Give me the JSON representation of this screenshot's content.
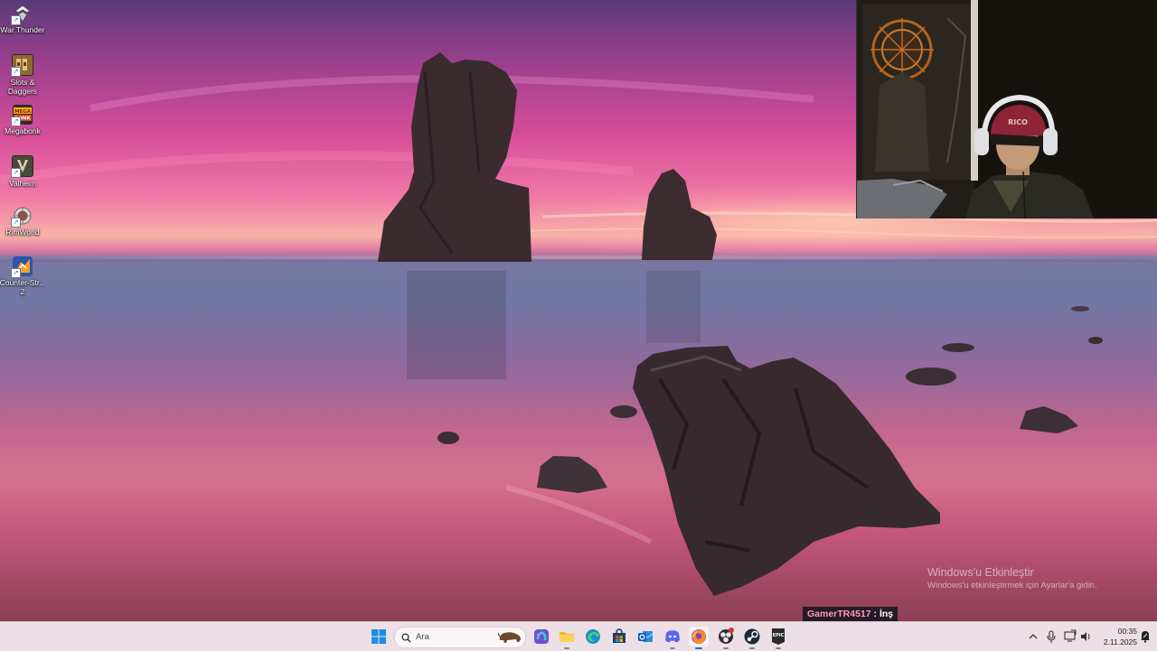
{
  "desktop_icons": [
    {
      "label": "War Thunder",
      "icon": "war-thunder-icon",
      "color": "#5b6b86"
    },
    {
      "label": "Slots & Daggers",
      "icon": "slots-daggers-icon",
      "color": "#8a6a3a"
    },
    {
      "label": "Megabonk",
      "icon": "megabonk-icon",
      "color": "#d8411d"
    },
    {
      "label": "Valheim",
      "icon": "valheim-icon",
      "color": "#4a4a3a"
    },
    {
      "label": "RimWorld",
      "icon": "rimworld-icon",
      "color": "#c9c9c9"
    },
    {
      "label": "Counter-Strike 2",
      "display_label": "Counter-Str... 2",
      "icon": "counter-strike-icon",
      "color": "#3a5fb0"
    }
  ],
  "activation": {
    "title": "Windows'u Etkinleştir",
    "subtitle": "Windows'u etkinleştirmek için Ayarlar'a gidin."
  },
  "chat": {
    "user": "GamerTR4517",
    "separator": " : ",
    "message": "İnş"
  },
  "taskbar": {
    "search_placeholder": "Ara",
    "pinned": [
      {
        "name": "start-button",
        "icon": "windows-logo-icon"
      },
      {
        "name": "copilot-button",
        "icon": "copilot-icon"
      },
      {
        "name": "file-explorer-button",
        "icon": "folder-icon"
      },
      {
        "name": "edge-button",
        "icon": "edge-icon"
      },
      {
        "name": "store-button",
        "icon": "store-icon"
      },
      {
        "name": "outlook-button",
        "icon": "outlook-icon"
      },
      {
        "name": "discord-button",
        "icon": "discord-icon"
      },
      {
        "name": "firefox-button",
        "icon": "firefox-icon"
      },
      {
        "name": "obs-button",
        "icon": "obs-icon"
      },
      {
        "name": "steam-button",
        "icon": "steam-icon"
      },
      {
        "name": "epic-games-button",
        "icon": "epic-games-icon"
      }
    ],
    "epic_label": "EPIC",
    "clock": {
      "time": "00:35",
      "date": "2.11.2025"
    }
  },
  "colors": {
    "taskbar_bg": "#ecdfe6",
    "chat_user": "#ff9ab5",
    "accent": "#2a6bd0"
  }
}
